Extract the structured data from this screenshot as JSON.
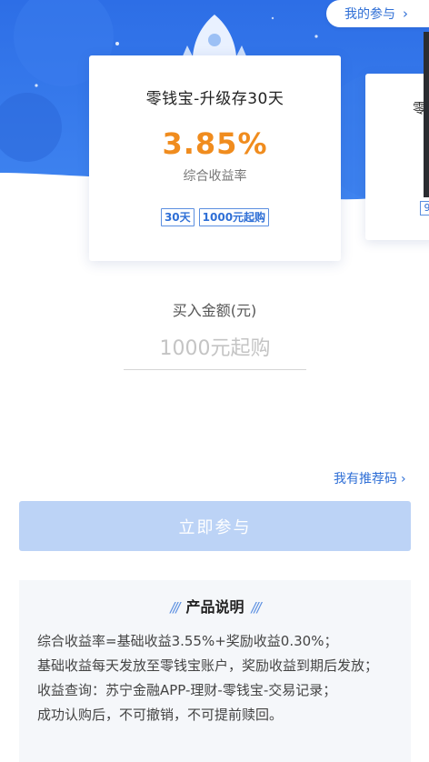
{
  "header": {
    "my_participation": "我的参与",
    "chevron": "›"
  },
  "product_card": {
    "title": "零钱宝-升级存30天",
    "rate": "3.85%",
    "rate_label": "综合收益率",
    "tags": [
      "30天",
      "1000元起购"
    ]
  },
  "next_card": {
    "title_partial": "零",
    "tag_partial": "9"
  },
  "purchase": {
    "amount_label": "买入金额(元)",
    "amount_placeholder": "1000元起购",
    "amount_value": ""
  },
  "referral": {
    "label": "我有推荐码",
    "chevron": "›"
  },
  "actions": {
    "join_label": "立即参与"
  },
  "description": {
    "title": "产品说明",
    "deco_left": "///",
    "deco_right": "///",
    "lines": [
      "综合收益率=基础收益3.55%+奖励收益0.30%；",
      "基础收益每天发放至零钱宝账户，奖励收益到期后发放；",
      "收益查询：苏宁金融APP-理财-零钱宝-交易记录；",
      "成功认购后，不可撤销，不可提前赎回。"
    ]
  },
  "colors": {
    "brand_blue": "#2f6fd6",
    "rate_orange": "#f08c1e",
    "button_disabled": "#bcd3f6"
  }
}
